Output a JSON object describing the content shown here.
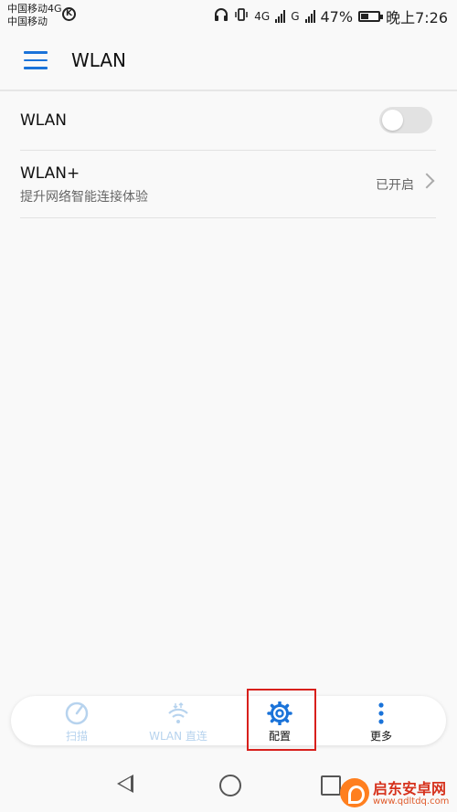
{
  "status_bar": {
    "carrier_line1": "中国移动4G",
    "carrier_line2": "中国移动",
    "k_badge": "K",
    "net1": "4G",
    "net2": "G",
    "battery_text": "47%",
    "battery_level": 0.47,
    "time": "晚上7:26"
  },
  "app_bar": {
    "title": "WLAN",
    "menu_icon": "hamburger-menu-icon"
  },
  "settings": [
    {
      "title": "WLAN",
      "toggle_on": false
    },
    {
      "title": "WLAN+",
      "subtitle": "提升网络智能连接体验",
      "value": "已开启"
    }
  ],
  "toolbar": {
    "items": [
      {
        "label": "扫描",
        "icon": "scan-icon",
        "enabled": false
      },
      {
        "label": "WLAN 直连",
        "icon": "wifi-direct-icon",
        "enabled": false
      },
      {
        "label": "配置",
        "icon": "gear-icon",
        "enabled": true
      },
      {
        "label": "更多",
        "icon": "more-vertical-icon",
        "enabled": true
      }
    ]
  },
  "accent_color": "#1a73d9",
  "highlight_color": "#d8201c",
  "watermark": {
    "name": "启东安卓网",
    "url": "www.qdltdq.com"
  }
}
